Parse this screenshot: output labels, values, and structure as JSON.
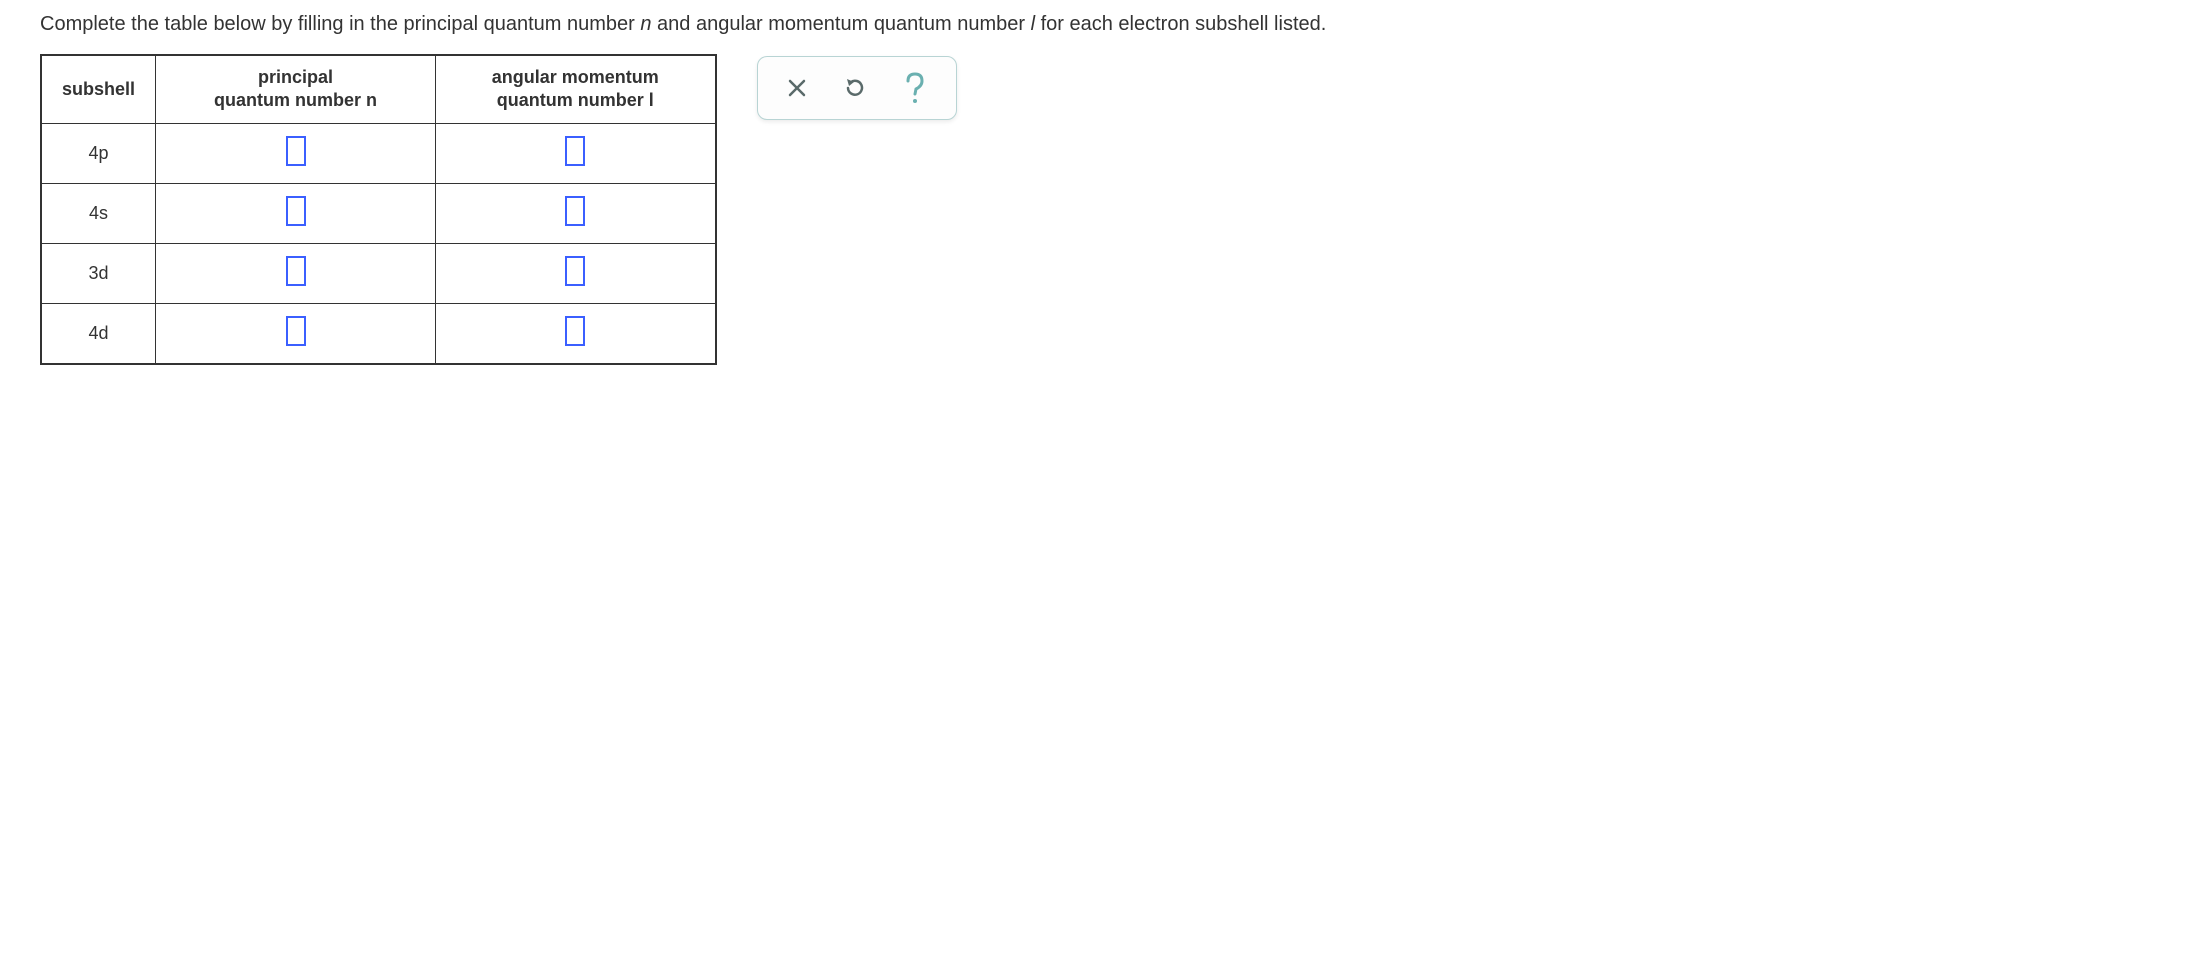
{
  "instruction": {
    "pre": "Complete the table below by filling in the principal quantum number ",
    "n": "n",
    "mid": " and angular momentum quantum number ",
    "l": "l",
    "post": " for each electron subshell listed."
  },
  "table": {
    "headers": {
      "subshell": "subshell",
      "principal_line1": "principal",
      "principal_line2_pre": "quantum number ",
      "principal_line2_var": "n",
      "angular_line1": "angular momentum",
      "angular_line2_pre": "quantum number ",
      "angular_line2_var": "l"
    },
    "rows": [
      {
        "subshell": "4p",
        "n": "",
        "l": ""
      },
      {
        "subshell": "4s",
        "n": "",
        "l": ""
      },
      {
        "subshell": "3d",
        "n": "",
        "l": ""
      },
      {
        "subshell": "4d",
        "n": "",
        "l": ""
      }
    ]
  },
  "toolbar": {
    "clear": "clear",
    "reset": "reset",
    "help": "help"
  }
}
